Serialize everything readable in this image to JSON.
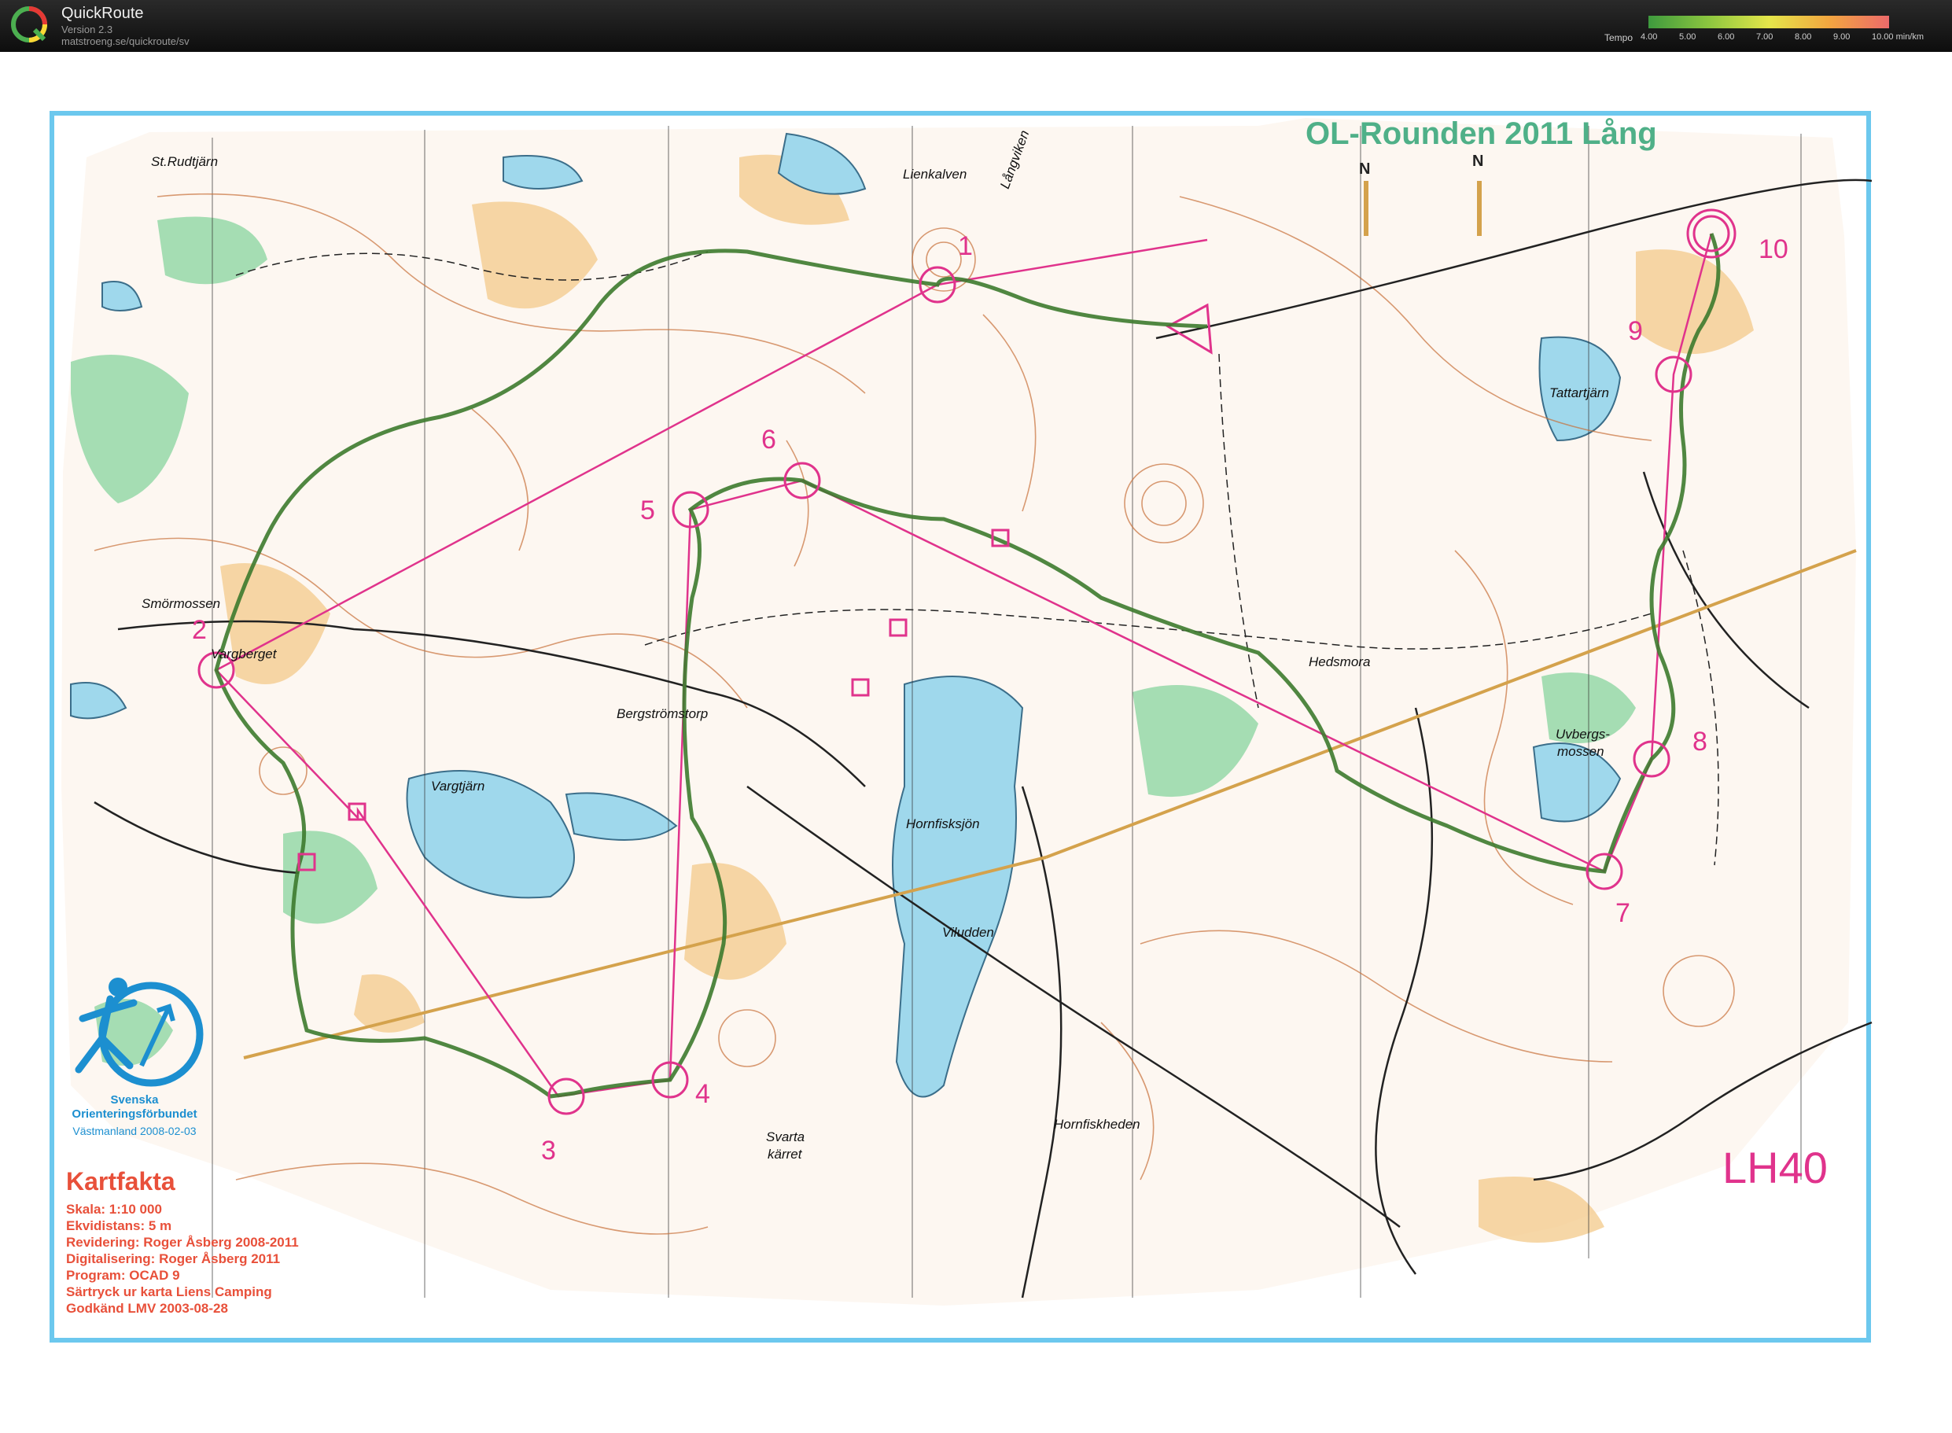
{
  "app": {
    "title": "QuickRoute",
    "version": "Version 2.3",
    "url": "matstroeng.se/quickroute/sv"
  },
  "tempo_legend": {
    "label": "Tempo",
    "ticks": [
      "4.00",
      "5.00",
      "6.00",
      "7.00",
      "8.00",
      "9.00",
      "10.00 min/km"
    ],
    "colors": [
      "#3e9a3e",
      "#8cc63f",
      "#e4e64a",
      "#f2a640",
      "#ec6a6a"
    ]
  },
  "map": {
    "title": "OL-Rounden 2011 Lång",
    "class": "LH40",
    "north_label": "N",
    "colors": {
      "course": "#e0338c",
      "route": "#3d7a2e",
      "water": "#9fd8ec",
      "open": "#f3c98a",
      "forest_green": "#8fd6a4",
      "contour": "#c8703a",
      "frame": "#6cc8ee"
    },
    "places": [
      {
        "id": "st-rudtjarn",
        "name": "St.Rudtjärn"
      },
      {
        "id": "lienkalven",
        "name": "Lienkalven"
      },
      {
        "id": "langviken",
        "name": "Långviken"
      },
      {
        "id": "smormossen",
        "name": "Smörmossen"
      },
      {
        "id": "vargberget",
        "name": "Vargberget"
      },
      {
        "id": "bergstromstorp",
        "name": "Bergströmstorp"
      },
      {
        "id": "vargtjarn",
        "name": "Vargtjärn"
      },
      {
        "id": "hornfisksjon",
        "name": "Hornfisksjön"
      },
      {
        "id": "viludden",
        "name": "Viludden"
      },
      {
        "id": "svarta",
        "name": "Svarta"
      },
      {
        "id": "karret",
        "name": "kärret"
      },
      {
        "id": "hornfiskheden",
        "name": "Hornfiskheden"
      },
      {
        "id": "hedsmora",
        "name": "Hedsmora"
      },
      {
        "id": "tattartjarn",
        "name": "Tattartjärn"
      },
      {
        "id": "uvbergs",
        "name": "Uvbergs-"
      },
      {
        "id": "mossen",
        "name": "mossen"
      }
    ],
    "controls": [
      "1",
      "2",
      "3",
      "4",
      "5",
      "6",
      "7",
      "8",
      "9",
      "10"
    ],
    "club": {
      "line1": "Svenska",
      "line2": "Orienteringsförbundet",
      "date": "Västmanland 2008-02-03"
    },
    "kartfakta": {
      "title": "Kartfakta",
      "lines": [
        "Skala: 1:10 000",
        "Ekvidistans: 5 m",
        "Revidering: Roger Åsberg 2008-2011",
        "Digitalisering: Roger Åsberg 2011",
        "Program: OCAD 9",
        "Särtryck ur karta Liens Camping",
        "Godkänd LMV 2003-08-28"
      ]
    }
  }
}
